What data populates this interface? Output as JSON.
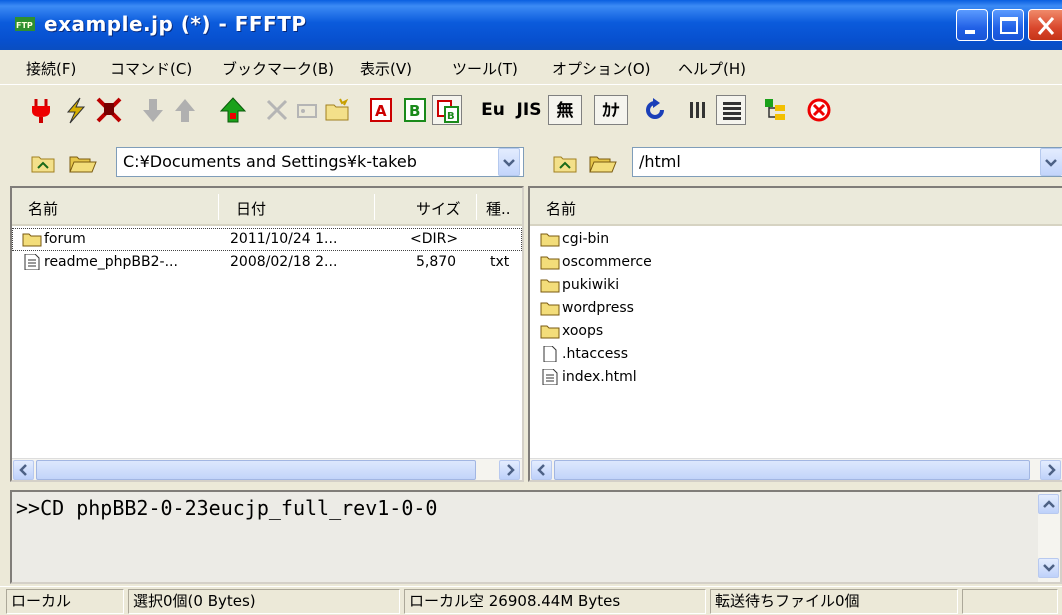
{
  "window": {
    "title": "example.jp (*) - FFFTP"
  },
  "menu": [
    "接続(F)",
    "コマンド(C)",
    "ブックマーク(B)",
    "表示(V)",
    "ツール(T)",
    "オプション(O)",
    "ヘルプ(H)"
  ],
  "toolbar": {
    "eu_label": "Eu",
    "js_label": "JIS",
    "mu_label": "無",
    "ka_label": "ｶﾅ"
  },
  "local": {
    "path": "C:¥Documents and Settings¥k-takeb",
    "columns": {
      "name": "名前",
      "date": "日付",
      "size": "サイズ",
      "type": "種.."
    },
    "files": [
      {
        "name": "forum",
        "date": "2011/10/24 1...",
        "size": "<DIR>",
        "type": "",
        "icon": "folder-icon"
      },
      {
        "name": "readme_phpBB2-...",
        "date": "2008/02/18 2...",
        "size": "5,870",
        "type": "txt",
        "icon": "text-file-icon"
      }
    ]
  },
  "remote": {
    "path": "/html",
    "columns": {
      "name": "名前"
    },
    "files": [
      {
        "name": "cgi-bin",
        "icon": "folder-icon"
      },
      {
        "name": "oscommerce",
        "icon": "folder-icon"
      },
      {
        "name": "pukiwiki",
        "icon": "folder-icon"
      },
      {
        "name": "wordpress",
        "icon": "folder-icon"
      },
      {
        "name": "xoops",
        "icon": "folder-icon"
      },
      {
        "name": ".htaccess",
        "icon": "blank-file-icon"
      },
      {
        "name": "index.html",
        "icon": "text-file-icon"
      }
    ]
  },
  "log": {
    "line": ">>CD phpBB2-0-23eucjp_full_rev1-0-0"
  },
  "status": {
    "mode": "ローカル",
    "selection": "選択0個(0 Bytes)",
    "free": "ローカル空 26908.44M Bytes",
    "queue": "転送待ちファイル0個"
  },
  "colors": {
    "titlebar": "#0a5fe0",
    "accent_green": "#1aa11a",
    "accent_red": "#e00000"
  }
}
